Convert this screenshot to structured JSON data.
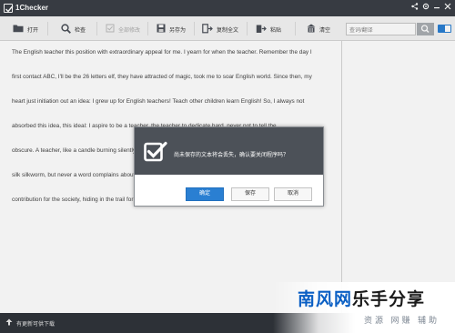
{
  "window": {
    "title": "1Checker",
    "controls": [
      "share-icon",
      "settings-icon",
      "minimize-icon",
      "close-icon"
    ]
  },
  "toolbar": {
    "open_label": "打开",
    "check_label": "检查",
    "ignore_all_label": "全部修改",
    "save_as_label": "另存为",
    "copy_all_label": "复制全文",
    "paste_label": "粘贴",
    "clear_label": "清空"
  },
  "search": {
    "placeholder": "查词/翻译"
  },
  "editor": {
    "lines": [
      "The English teacher this position with extraordinary appeal for me. I yearn for when the teacher. Remember the day I",
      "first contact ABC, I'll be the 26 letters elf, they have attracted of magic, took me to soar English world. Since then, my",
      "heart just initiation out an idea: I grew up for English teachers! Teach other children learn English! So, I always not",
      "absorbed this idea, this ideal: I aspire to be a teacher, the teacher to dedicate hard, never not to tell the",
      "obscure. A teacher, like a candle burning silently, illuminate others, and contribute to others. A teacher, like a hard",
      "silk silkworm, but never a word complains about their hard, only silently contributing. A teacher, take root in",
      "contribution for the society, hiding in the trail for the world."
    ]
  },
  "dialog": {
    "message": "尚未保存的文本将会丢失，确认要关闭程序吗？",
    "confirm_label": "确定",
    "save_label": "保存",
    "cancel_label": "取消"
  },
  "statusbar": {
    "update_text": "有更新可供下载"
  },
  "watermark": {
    "logo_blue": "南风网",
    "logo_dark": "乐手分享",
    "subtitle": "资源 网赚 辅助"
  },
  "colors": {
    "accent": "#2a7fd2",
    "titlebar": "#3a3f46",
    "dialog_header": "#4c5158",
    "statusbar": "#2d3137",
    "watermark_blue": "#0a5fc4"
  }
}
